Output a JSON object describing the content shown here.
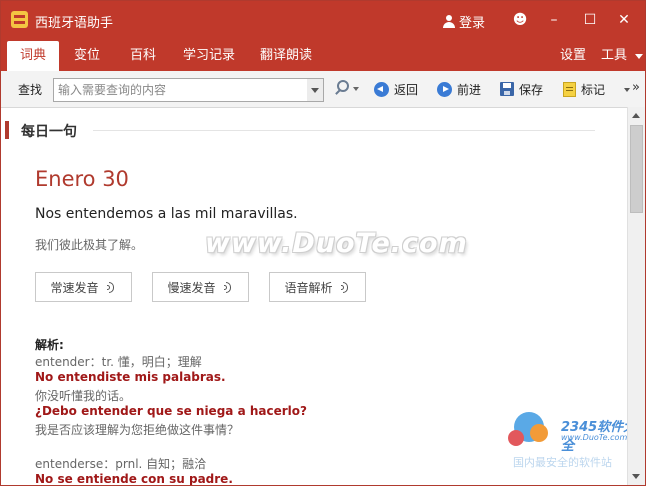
{
  "app": {
    "title": "西班牙语助手",
    "login_label": "登录"
  },
  "window_controls": {
    "minimize": "–",
    "maximize": "☐",
    "close": "✕"
  },
  "menu": {
    "tabs": [
      "词典",
      "变位",
      "百科",
      "学习记录",
      "翻译朗读"
    ],
    "active_tab": "词典",
    "settings_label": "设置",
    "tools_label": "工具"
  },
  "toolbar": {
    "search_label": "查找",
    "search_placeholder": "输入需要查询的内容",
    "back_label": "返回",
    "forward_label": "前进",
    "save_label": "保存",
    "bookmark_label": "标记",
    "more_label": "»"
  },
  "content": {
    "section_title": "每日一句",
    "date_title": "Enero 30",
    "sentence_es": "Nos entendemos a las mil maravillas.",
    "sentence_zh": "我们彼此极其了解。",
    "audio_buttons": [
      "常速发音",
      "慢速发音",
      "语音解析"
    ],
    "analysis_title": "解析:",
    "analysis_lines": [
      {
        "text": "entender：tr. 懂，明白；理解",
        "style": "gray"
      },
      {
        "text": "No entendiste mis palabras.",
        "style": "red"
      },
      {
        "text": "你没听懂我的话。",
        "style": "gray"
      },
      {
        "text": "¿Debo entender que se niega a hacerlo?",
        "style": "red"
      },
      {
        "text": "我是否应该理解为您拒绝做这件事情？",
        "style": "gray"
      },
      {
        "text": "entenderse：prnl. 自知；融洽",
        "style": "gray"
      },
      {
        "text": "No se entiende con su padre.",
        "style": "red"
      }
    ]
  },
  "watermarks": {
    "duote": "www.DuoTe.com",
    "brand": "2345软件大全",
    "brand_url": "www.DuoTe.com",
    "brand_note": "国内最安全的软件站"
  },
  "colors": {
    "accent": "#c0392b",
    "example_red": "#a01818",
    "link_blue": "#3a7bd5"
  }
}
